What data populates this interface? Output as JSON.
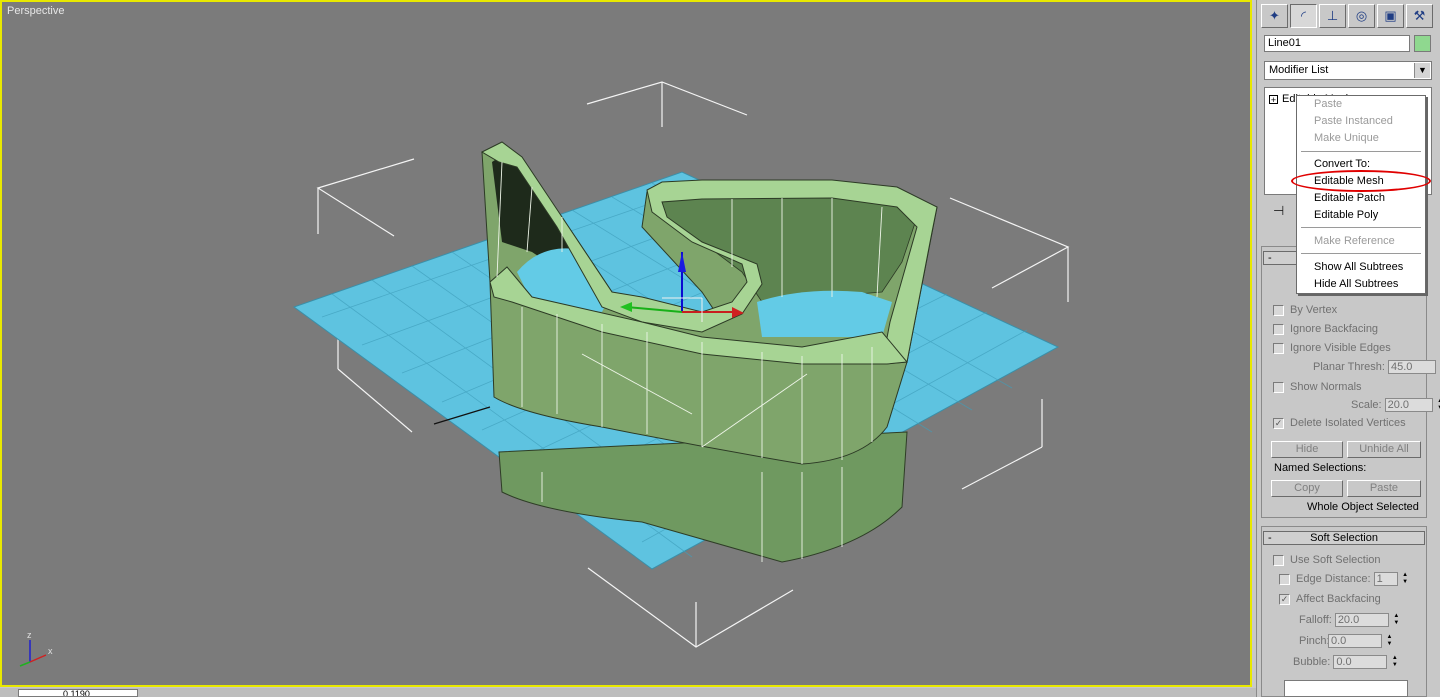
{
  "viewport": {
    "label": "Perspective",
    "axis_labels": {
      "z": "z",
      "x": "x"
    }
  },
  "status": {
    "value": "0.1190"
  },
  "command_panel": {
    "tabs": [
      {
        "name": "create",
        "icon": "cursor-star-icon"
      },
      {
        "name": "modify",
        "icon": "modify-arc-icon"
      },
      {
        "name": "hierarchy",
        "icon": "hierarchy-icon"
      },
      {
        "name": "motion",
        "icon": "motion-icon"
      },
      {
        "name": "display",
        "icon": "display-monitor-icon"
      },
      {
        "name": "utilities",
        "icon": "hammer-icon"
      }
    ],
    "object_name": "Line01",
    "object_color": "#8fd88f",
    "modifier_list": "Modifier List",
    "stack_item": "Editable Mesh"
  },
  "context_menu": {
    "items": [
      {
        "label": "Paste",
        "disabled": true
      },
      {
        "label": "Paste Instanced",
        "disabled": true
      },
      {
        "label": "Make Unique",
        "disabled": true
      },
      {
        "label": "Convert To:",
        "disabled": false
      },
      {
        "label": "Editable Mesh",
        "disabled": false,
        "highlighted": true
      },
      {
        "label": "Editable Patch",
        "disabled": false
      },
      {
        "label": "Editable Poly",
        "disabled": false
      },
      {
        "label": "Make Reference",
        "disabled": true
      },
      {
        "label": "Show All Subtrees",
        "disabled": false
      },
      {
        "label": "Hide All Subtrees",
        "disabled": false
      }
    ]
  },
  "selection": {
    "by_vertex": "By Vertex",
    "ignore_backfacing": "Ignore Backfacing",
    "ignore_visible_edges": "Ignore Visible Edges",
    "planar_thresh_label": "Planar Thresh:",
    "planar_thresh_value": "45.0",
    "show_normals": "Show Normals",
    "scale_label": "Scale:",
    "scale_value": "20.0",
    "delete_isolated": "Delete Isolated Vertices",
    "delete_isolated_checked": true,
    "hide_button": "Hide",
    "unhide_all_button": "Unhide All",
    "named_selections_label": "Named Selections:",
    "copy_button": "Copy",
    "paste_button": "Paste",
    "status_text": "Whole Object Selected"
  },
  "soft_selection": {
    "title": "Soft Selection",
    "use_soft_selection": "Use Soft Selection",
    "edge_distance_label": "Edge Distance:",
    "edge_distance_value": "1",
    "affect_backfacing": "Affect Backfacing",
    "affect_backfacing_checked": true,
    "falloff_label": "Falloff:",
    "falloff_value": "20.0",
    "pinch_label": "Pinch:",
    "pinch_value": "0.0",
    "bubble_label": "Bubble:",
    "bubble_value": "0.0"
  },
  "colors": {
    "viewport_bg": "#7b7b7b",
    "active_border": "#e8e800",
    "mesh_green": "#7fa56b",
    "plane_cyan": "#5ec3e0",
    "highlight_red": "#e00000"
  }
}
